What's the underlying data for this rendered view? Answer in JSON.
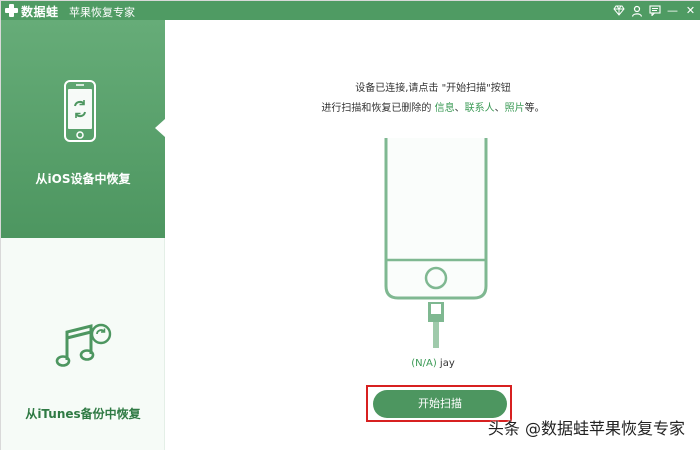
{
  "titlebar": {
    "brand": "数据蛙",
    "subtitle": "苹果恢复专家",
    "icons": [
      "diamond-icon",
      "person-icon",
      "message-icon",
      "minimize-icon",
      "close-icon"
    ],
    "minimize_glyph": "—",
    "close_glyph": "✕"
  },
  "sidebar": {
    "items": [
      {
        "label": "从iOS设备中恢复",
        "icon": "phone-icon",
        "active": true
      },
      {
        "label": "从iTunes备份中恢复",
        "icon": "music-note-icon",
        "active": false
      }
    ]
  },
  "main": {
    "instruction_line1": "设备已连接,请点击 \"开始扫描\"按钮",
    "instruction_line2_prefix": "进行扫描和恢复已删除的 ",
    "link_info": "信息",
    "sep1": "、",
    "link_contacts": "联系人",
    "sep2": "、",
    "link_photos": "照片",
    "instruction_line2_suffix": "等。",
    "device_status": "(N/A)",
    "device_name": "jay",
    "scan_button": "开始扫描"
  },
  "watermark": "头条 @数据蛙苹果恢复专家",
  "colors": {
    "brand_green": "#4f9b63",
    "link_green": "#3a9a55",
    "highlight_red": "#d72020"
  }
}
